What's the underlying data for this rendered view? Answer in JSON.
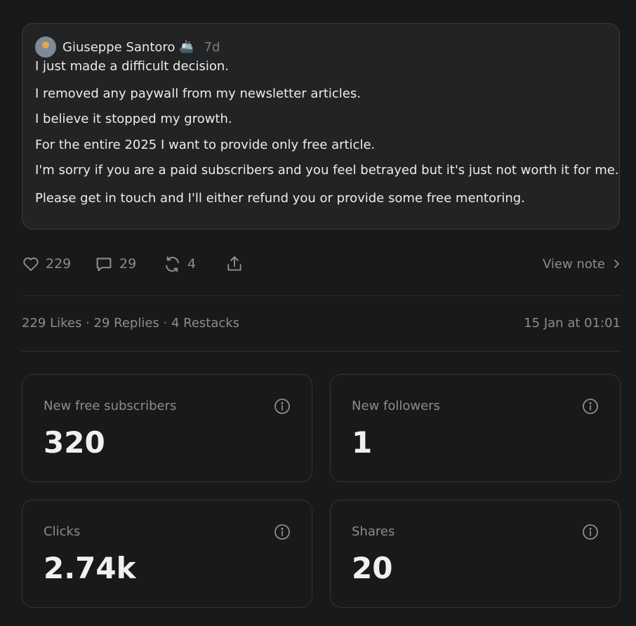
{
  "note": {
    "author": "Giuseppe Santoro",
    "author_emoji": "🚢",
    "age": "7d",
    "lines": [
      "I just made a difficult decision.",
      "I removed any paywall from my newsletter articles.",
      "I believe it stopped my growth.",
      "For the entire 2025 I want to provide only free article.",
      "I'm sorry if you are a paid subscribers and you feel betrayed but it's just not worth it for me.",
      "Please get in touch and I'll either refund you or provide some free mentoring."
    ]
  },
  "actions": {
    "likes": "229",
    "replies": "29",
    "restacks": "4",
    "view_note": "View note",
    "icons": [
      "heart-icon",
      "comment-icon",
      "restack-icon",
      "share-icon",
      "chevron-right-icon"
    ]
  },
  "stats": {
    "summary": "229 Likes · 29 Replies · 4 Restacks",
    "timestamp": "15 Jan at 01:01"
  },
  "metrics": [
    {
      "label": "New free subscribers",
      "value": "320"
    },
    {
      "label": "New followers",
      "value": "1"
    },
    {
      "label": "Clicks",
      "value": "2.74k"
    },
    {
      "label": "Shares",
      "value": "20"
    }
  ],
  "colors": {
    "background": "#18191b",
    "card": "#222324",
    "muted_text": "#8b8c8e"
  }
}
